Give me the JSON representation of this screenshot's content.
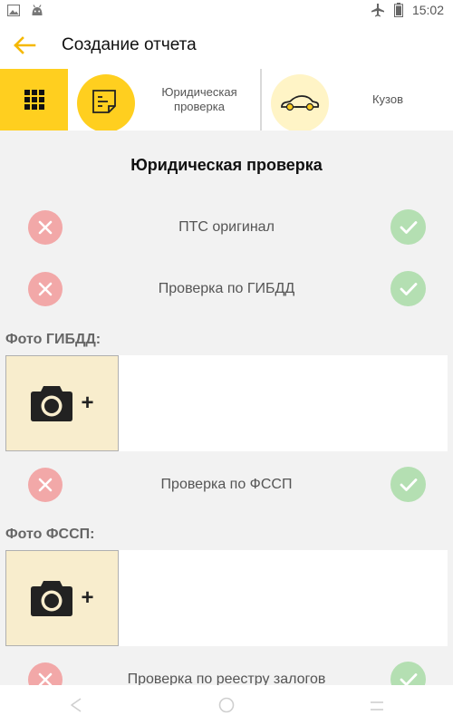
{
  "status_bar": {
    "time": "15:02",
    "icons": [
      "image-icon",
      "android-icon",
      "airplane-icon",
      "battery-icon"
    ]
  },
  "app_bar": {
    "title": "Создание отчета",
    "back_icon": "arrow-left-icon"
  },
  "tabs": [
    {
      "label": "Юридическая проверка",
      "icon": "document-icon",
      "active": true
    },
    {
      "label": "Кузов",
      "icon": "car-icon",
      "active": false
    }
  ],
  "menu_icon": "grid-icon",
  "section": {
    "title": "Юридическая проверка"
  },
  "checks": [
    {
      "label": "ПТС оригинал"
    },
    {
      "label": "Проверка по ГИБДД"
    },
    {
      "label": "Проверка по ФССП"
    },
    {
      "label": "Проверка по реестру залогов"
    }
  ],
  "photos": [
    {
      "label": "Фото ГИБДД:",
      "add_symbol": "+"
    },
    {
      "label": "Фото ФССП:",
      "add_symbol": "+"
    }
  ],
  "colors": {
    "accent": "#ffcf1f",
    "reject": "#f2a8a8",
    "approve": "#b4dfb2",
    "photo_bg": "#f8edcd"
  },
  "nav_bar": {
    "icons": [
      "back-triangle-icon",
      "home-circle-icon",
      "recents-icon"
    ]
  }
}
